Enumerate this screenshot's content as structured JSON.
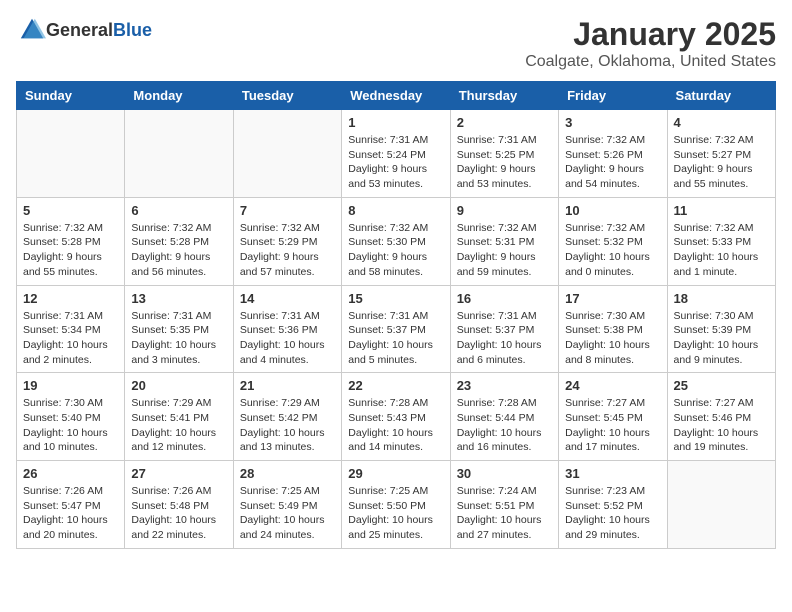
{
  "header": {
    "logo_general": "General",
    "logo_blue": "Blue",
    "month_year": "January 2025",
    "location": "Coalgate, Oklahoma, United States"
  },
  "weekdays": [
    "Sunday",
    "Monday",
    "Tuesday",
    "Wednesday",
    "Thursday",
    "Friday",
    "Saturday"
  ],
  "weeks": [
    [
      {
        "day": "",
        "info": ""
      },
      {
        "day": "",
        "info": ""
      },
      {
        "day": "",
        "info": ""
      },
      {
        "day": "1",
        "info": "Sunrise: 7:31 AM\nSunset: 5:24 PM\nDaylight: 9 hours and 53 minutes."
      },
      {
        "day": "2",
        "info": "Sunrise: 7:31 AM\nSunset: 5:25 PM\nDaylight: 9 hours and 53 minutes."
      },
      {
        "day": "3",
        "info": "Sunrise: 7:32 AM\nSunset: 5:26 PM\nDaylight: 9 hours and 54 minutes."
      },
      {
        "day": "4",
        "info": "Sunrise: 7:32 AM\nSunset: 5:27 PM\nDaylight: 9 hours and 55 minutes."
      }
    ],
    [
      {
        "day": "5",
        "info": "Sunrise: 7:32 AM\nSunset: 5:28 PM\nDaylight: 9 hours and 55 minutes."
      },
      {
        "day": "6",
        "info": "Sunrise: 7:32 AM\nSunset: 5:28 PM\nDaylight: 9 hours and 56 minutes."
      },
      {
        "day": "7",
        "info": "Sunrise: 7:32 AM\nSunset: 5:29 PM\nDaylight: 9 hours and 57 minutes."
      },
      {
        "day": "8",
        "info": "Sunrise: 7:32 AM\nSunset: 5:30 PM\nDaylight: 9 hours and 58 minutes."
      },
      {
        "day": "9",
        "info": "Sunrise: 7:32 AM\nSunset: 5:31 PM\nDaylight: 9 hours and 59 minutes."
      },
      {
        "day": "10",
        "info": "Sunrise: 7:32 AM\nSunset: 5:32 PM\nDaylight: 10 hours and 0 minutes."
      },
      {
        "day": "11",
        "info": "Sunrise: 7:32 AM\nSunset: 5:33 PM\nDaylight: 10 hours and 1 minute."
      }
    ],
    [
      {
        "day": "12",
        "info": "Sunrise: 7:31 AM\nSunset: 5:34 PM\nDaylight: 10 hours and 2 minutes."
      },
      {
        "day": "13",
        "info": "Sunrise: 7:31 AM\nSunset: 5:35 PM\nDaylight: 10 hours and 3 minutes."
      },
      {
        "day": "14",
        "info": "Sunrise: 7:31 AM\nSunset: 5:36 PM\nDaylight: 10 hours and 4 minutes."
      },
      {
        "day": "15",
        "info": "Sunrise: 7:31 AM\nSunset: 5:37 PM\nDaylight: 10 hours and 5 minutes."
      },
      {
        "day": "16",
        "info": "Sunrise: 7:31 AM\nSunset: 5:37 PM\nDaylight: 10 hours and 6 minutes."
      },
      {
        "day": "17",
        "info": "Sunrise: 7:30 AM\nSunset: 5:38 PM\nDaylight: 10 hours and 8 minutes."
      },
      {
        "day": "18",
        "info": "Sunrise: 7:30 AM\nSunset: 5:39 PM\nDaylight: 10 hours and 9 minutes."
      }
    ],
    [
      {
        "day": "19",
        "info": "Sunrise: 7:30 AM\nSunset: 5:40 PM\nDaylight: 10 hours and 10 minutes."
      },
      {
        "day": "20",
        "info": "Sunrise: 7:29 AM\nSunset: 5:41 PM\nDaylight: 10 hours and 12 minutes."
      },
      {
        "day": "21",
        "info": "Sunrise: 7:29 AM\nSunset: 5:42 PM\nDaylight: 10 hours and 13 minutes."
      },
      {
        "day": "22",
        "info": "Sunrise: 7:28 AM\nSunset: 5:43 PM\nDaylight: 10 hours and 14 minutes."
      },
      {
        "day": "23",
        "info": "Sunrise: 7:28 AM\nSunset: 5:44 PM\nDaylight: 10 hours and 16 minutes."
      },
      {
        "day": "24",
        "info": "Sunrise: 7:27 AM\nSunset: 5:45 PM\nDaylight: 10 hours and 17 minutes."
      },
      {
        "day": "25",
        "info": "Sunrise: 7:27 AM\nSunset: 5:46 PM\nDaylight: 10 hours and 19 minutes."
      }
    ],
    [
      {
        "day": "26",
        "info": "Sunrise: 7:26 AM\nSunset: 5:47 PM\nDaylight: 10 hours and 20 minutes."
      },
      {
        "day": "27",
        "info": "Sunrise: 7:26 AM\nSunset: 5:48 PM\nDaylight: 10 hours and 22 minutes."
      },
      {
        "day": "28",
        "info": "Sunrise: 7:25 AM\nSunset: 5:49 PM\nDaylight: 10 hours and 24 minutes."
      },
      {
        "day": "29",
        "info": "Sunrise: 7:25 AM\nSunset: 5:50 PM\nDaylight: 10 hours and 25 minutes."
      },
      {
        "day": "30",
        "info": "Sunrise: 7:24 AM\nSunset: 5:51 PM\nDaylight: 10 hours and 27 minutes."
      },
      {
        "day": "31",
        "info": "Sunrise: 7:23 AM\nSunset: 5:52 PM\nDaylight: 10 hours and 29 minutes."
      },
      {
        "day": "",
        "info": ""
      }
    ]
  ]
}
